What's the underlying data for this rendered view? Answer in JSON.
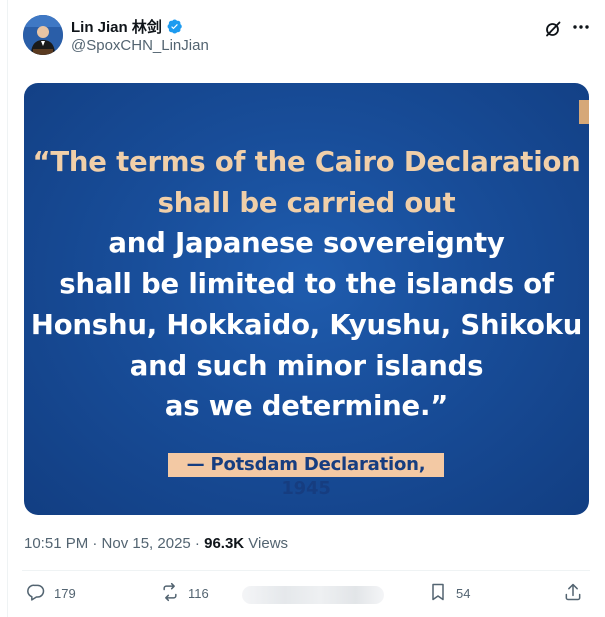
{
  "post": {
    "author_name": "Lin Jian 林剑",
    "handle": "@SpoxCHN_LinJian",
    "timestamp": "10:51 PM · Nov 15, 2025 · ",
    "views_count": "96.3K",
    "views_label": " Views"
  },
  "media": {
    "quote_lines_gold": [
      "“The terms of the Cairo Declaration",
      "shall be carried out"
    ],
    "quote_lines_white": [
      "and Japanese sovereignty",
      "shall be limited to the islands of",
      "Honshu, Hokkaido, Kyushu, Shikoku",
      "and such minor islands",
      "as we determine.”"
    ],
    "attribution": "— Potsdam Declaration, 1945"
  },
  "actions": {
    "replies": "179",
    "reposts": "116",
    "bookmarks": "54"
  },
  "colors": {
    "accent_blue": "#1d9bf0",
    "secondary_text": "#536471",
    "media_blue": "#184d99",
    "quote_gold": "#f0cfa9"
  },
  "icons": [
    "verified-badge-icon",
    "grok-icon",
    "more-icon",
    "reply-icon",
    "repost-icon",
    "bookmark-icon",
    "share-icon"
  ]
}
